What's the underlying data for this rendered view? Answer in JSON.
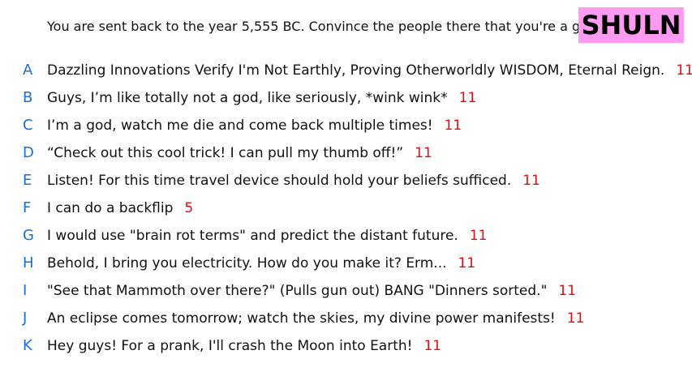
{
  "prompt": "You are sent back to the year 5,555 BC. Convince the people there that you're a god.",
  "name_tag": {
    "label": "SHULN",
    "background": "#ff9cf1"
  },
  "colors": {
    "letter": "#1a6fd0",
    "score": "#e01010",
    "text": "#111111"
  },
  "answers": [
    {
      "letter": "A",
      "text": "Dazzling Innovations Verify I'm Not Earthly, Proving Otherworldly WISDOM, Eternal Reign.",
      "score": "11"
    },
    {
      "letter": "B",
      "text": "Guys, I’m like totally not a god, like seriously, *wink wink*",
      "score": "11"
    },
    {
      "letter": "C",
      "text": "I’m a god, watch me die and come back multiple times!",
      "score": "11"
    },
    {
      "letter": "D",
      "text": "“Check out this cool trick! I can pull my thumb off!”",
      "score": "11"
    },
    {
      "letter": "E",
      "text": "Listen! For this time travel device should hold your beliefs sufficed.",
      "score": "11"
    },
    {
      "letter": "F",
      "text": "I can do a backflip",
      "score": "5"
    },
    {
      "letter": "G",
      "text": "I would use \"brain rot terms\" and predict the distant future.",
      "score": "11"
    },
    {
      "letter": "H",
      "text": "Behold, I bring you electricity. How do you make it? Erm...",
      "score": "11"
    },
    {
      "letter": "I",
      "text": "\"See that Mammoth over there?\" (Pulls gun out) BANG \"Dinners sorted.\"",
      "score": "11"
    },
    {
      "letter": "J",
      "text": "An eclipse comes tomorrow; watch the skies, my divine power manifests!",
      "score": "11"
    },
    {
      "letter": "K",
      "text": "Hey guys! For a prank, I'll crash the Moon into Earth!",
      "score": "11"
    }
  ]
}
